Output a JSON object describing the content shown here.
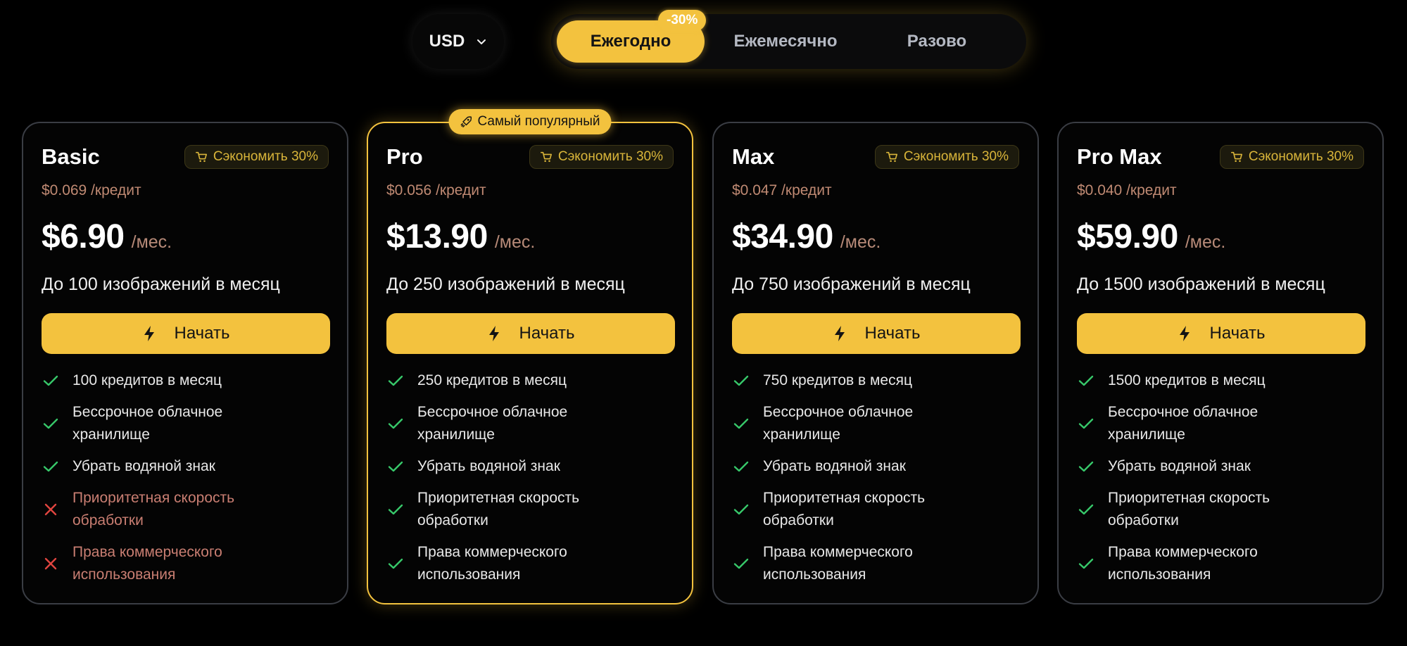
{
  "currency": {
    "label": "USD"
  },
  "billing": {
    "options": [
      "Ежегодно",
      "Ежемесячно",
      "Разово"
    ],
    "active_index": 0,
    "discount_badge": "-30%"
  },
  "colors": {
    "accent": "#f3c23e",
    "check": "#37c86a",
    "cross": "#e0453f",
    "background": "#000000"
  },
  "plans": [
    {
      "name": "Basic",
      "save_badge": "Сэкономить 30%",
      "credit_price": "$0.069 /кредит",
      "price": "$6.90",
      "period": "/мес.",
      "images": "До 100 изображений в месяц",
      "cta": "Начать",
      "features": [
        {
          "text": "100 кредитов в месяц",
          "included": true
        },
        {
          "text": "Бессрочное облачное хранилище",
          "included": true
        },
        {
          "text": "Убрать водяной знак",
          "included": true
        },
        {
          "text": "Приоритетная скорость обработки",
          "included": false
        },
        {
          "text": "Права коммерческого использования",
          "included": false
        }
      ]
    },
    {
      "name": "Pro",
      "popular_badge": "Самый популярный",
      "save_badge": "Сэкономить 30%",
      "credit_price": "$0.056 /кредит",
      "price": "$13.90",
      "period": "/мес.",
      "images": "До 250 изображений в месяц",
      "cta": "Начать",
      "features": [
        {
          "text": "250 кредитов в месяц",
          "included": true
        },
        {
          "text": "Бессрочное облачное хранилище",
          "included": true
        },
        {
          "text": "Убрать водяной знак",
          "included": true
        },
        {
          "text": "Приоритетная скорость обработки",
          "included": true
        },
        {
          "text": "Права коммерческого использования",
          "included": true
        }
      ]
    },
    {
      "name": "Max",
      "save_badge": "Сэкономить 30%",
      "credit_price": "$0.047 /кредит",
      "price": "$34.90",
      "period": "/мес.",
      "images": "До 750 изображений в месяц",
      "cta": "Начать",
      "features": [
        {
          "text": "750 кредитов в месяц",
          "included": true
        },
        {
          "text": "Бессрочное облачное хранилище",
          "included": true
        },
        {
          "text": "Убрать водяной знак",
          "included": true
        },
        {
          "text": "Приоритетная скорость обработки",
          "included": true
        },
        {
          "text": "Права коммерческого использования",
          "included": true
        }
      ]
    },
    {
      "name": "Pro Max",
      "save_badge": "Сэкономить 30%",
      "credit_price": "$0.040 /кредит",
      "price": "$59.90",
      "period": "/мес.",
      "images": "До 1500 изображений в месяц",
      "cta": "Начать",
      "features": [
        {
          "text": "1500 кредитов в месяц",
          "included": true
        },
        {
          "text": "Бессрочное облачное хранилище",
          "included": true
        },
        {
          "text": "Убрать водяной знак",
          "included": true
        },
        {
          "text": "Приоритетная скорость обработки",
          "included": true
        },
        {
          "text": "Права коммерческого использования",
          "included": true
        }
      ]
    }
  ]
}
